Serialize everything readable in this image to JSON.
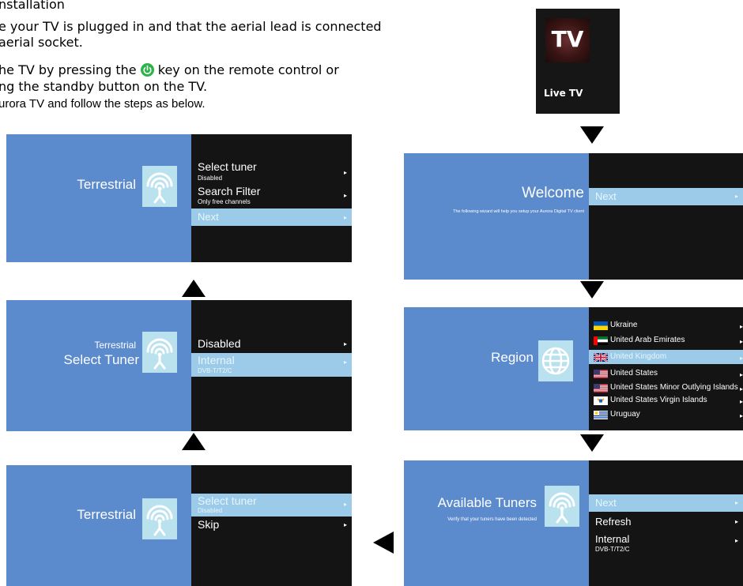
{
  "intro": {
    "heading": "nstallation",
    "line1": "e your TV is plugged in and that the aerial lead is connected",
    "line2": " aerial socket.",
    "line3a": "he TV by pressing the",
    "line3b": "key on the remote control or",
    "line4": "ng the standby button on the TV.",
    "line5": "urora TV and follow the steps as below."
  },
  "live_tv_tile": {
    "logo_text": "TV",
    "label": "Live TV"
  },
  "arrow_glyph": "▸",
  "welcome": {
    "title": "Welcome",
    "description": "The following wizard will help you setup your Aurora Digital TV client",
    "items": [
      {
        "label": "Next",
        "selected": true
      }
    ]
  },
  "region": {
    "title": "Region",
    "countries": [
      {
        "name": "Ukraine",
        "flag": "ukraine-flag"
      },
      {
        "name": "United Arab Emirates",
        "flag": "uae-flag"
      },
      {
        "name": "United Kingdom",
        "flag": "uk-flag",
        "selected": true
      },
      {
        "name": "United States",
        "flag": "us-flag"
      },
      {
        "name": "United States Minor Outlying Islands",
        "flag": "us-flag"
      },
      {
        "name": "United States Virgin Islands",
        "flag": "usvi-flag"
      },
      {
        "name": "Uruguay",
        "flag": "uruguay-flag"
      }
    ]
  },
  "available_tuners": {
    "title": "Available Tuners",
    "description": "Verify that your tuners have been detected",
    "items": [
      {
        "label": "Next",
        "selected": true
      },
      {
        "label": "Refresh"
      },
      {
        "label": "Internal",
        "sub": "DVB-T/T2/C"
      }
    ]
  },
  "terrestrial_step1": {
    "title": "Terrestrial",
    "items": [
      {
        "label": "Select tuner",
        "sub": "Disabled",
        "selected": true
      },
      {
        "label": "Skip"
      }
    ]
  },
  "select_tuner_step": {
    "subtitle": "Terrestrial",
    "title": "Select Tuner",
    "items": [
      {
        "label": "Disabled"
      },
      {
        "label": "Internal",
        "sub": "DVB-T/T2/C",
        "selected": true
      }
    ]
  },
  "terrestrial_step3": {
    "title": "Terrestrial",
    "items": [
      {
        "label": "Select tuner",
        "sub": "Disabled"
      },
      {
        "label": "Search Filter",
        "sub": "Only free channels"
      },
      {
        "label": "Next",
        "selected": true
      }
    ]
  },
  "colors": {
    "panel_blue": "#5b8bcd",
    "panel_black": "#141414",
    "selected_row": "#9bcbe8",
    "icon_bg": "#b9e1ee",
    "power_green": "#2db34a"
  }
}
